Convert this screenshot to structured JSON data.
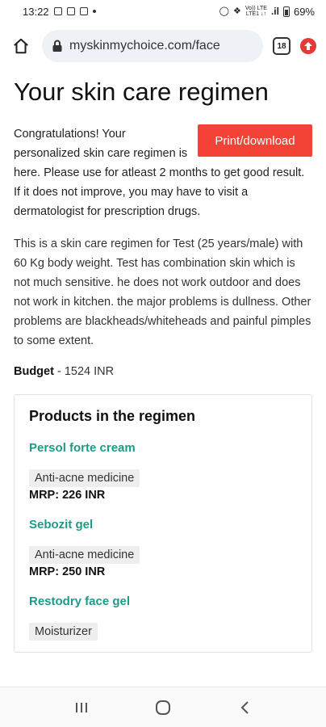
{
  "status_bar": {
    "time": "13:22",
    "network_top": "Vo)) LTE",
    "network_bottom": "LTE1 ↓↑",
    "signal": ".il",
    "battery": "69%"
  },
  "browser": {
    "url": "myskinmychoice.com/face",
    "tab_count": "18"
  },
  "page": {
    "title": "Your skin care regimen",
    "print_button": "Print/download",
    "intro": "Congratulations! Your personalized skin care regimen is here. Please use for atleast 2 months to get good result. If it does not improve, you may have to visit a dermatologist for prescription drugs.",
    "description": "This is a skin care regimen for Test (25 years/male) with 60 Kg body weight. Test has combination skin which is not much sensitive. he does not work outdoor and does not work in kitchen. the major problems is dullness. Other problems are blackheads/whiteheads and painful pimples to some extent.",
    "budget_label": "Budget",
    "budget_value": " - 1524 INR"
  },
  "products": {
    "title": "Products in the regimen",
    "items": [
      {
        "name": "Persol forte cream",
        "tag": "Anti-acne medicine",
        "mrp": "MRP: 226 INR"
      },
      {
        "name": "Sebozit gel",
        "tag": "Anti-acne medicine",
        "mrp": "MRP: 250 INR"
      },
      {
        "name": "Restodry face gel",
        "tag": "Moisturizer",
        "mrp": ""
      }
    ]
  },
  "colors": {
    "accent_button": "#f44336",
    "product_link": "#1e9a86"
  }
}
